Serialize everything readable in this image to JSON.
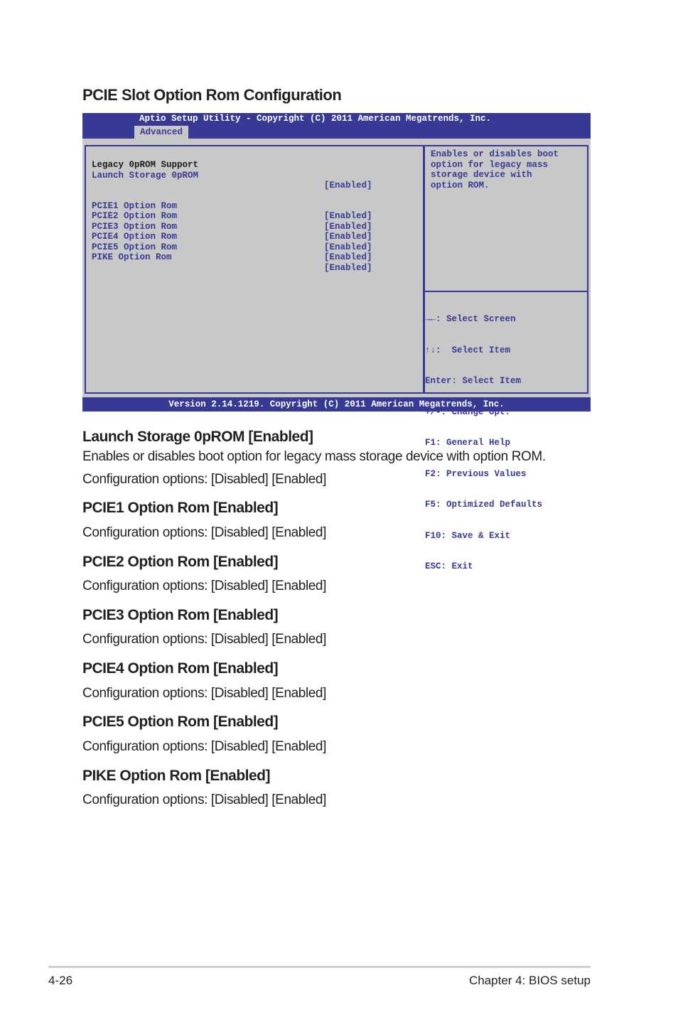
{
  "section_title": "PCIE Slot Option Rom Configuration",
  "bios": {
    "title": "Aptio Setup Utility - Copyright (C) 2011 American Megatrends, Inc.",
    "active_tab": "Advanced",
    "group_label": "Legacy 0pROM Support",
    "items": [
      {
        "label": "Launch Storage 0pROM",
        "value": "[Enabled]"
      },
      {
        "label": "PCIE1 Option Rom",
        "value": "[Enabled]"
      },
      {
        "label": "PCIE2 Option Rom",
        "value": "[Enabled]"
      },
      {
        "label": "PCIE3 Option Rom",
        "value": "[Enabled]"
      },
      {
        "label": "PCIE4 Option Rom",
        "value": "[Enabled]"
      },
      {
        "label": "PCIE5 Option Rom",
        "value": "[Enabled]"
      },
      {
        "label": "PIKE Option Rom",
        "value": "[Enabled]"
      }
    ],
    "help_text": "Enables or disables boot\noption for legacy mass\nstorage device with\noption ROM.",
    "key_legend": [
      "→←: Select Screen",
      "↑↓:  Select Item",
      "Enter: Select Item",
      "+/-: Change Opt.",
      "F1: General Help",
      "F2: Previous Values",
      "F5: Optimized Defaults",
      "F10: Save & Exit",
      "ESC: Exit"
    ],
    "footer": "Version 2.14.1219. Copyright (C) 2011 American Megatrends, Inc."
  },
  "descriptions": [
    {
      "title": "Launch Storage 0pROM [Enabled]",
      "text": "Enables or disables boot option for legacy mass storage device with option ROM.",
      "options": "Configuration options: [Disabled] [Enabled]"
    },
    {
      "title": "PCIE1 Option Rom [Enabled]",
      "options": "Configuration options: [Disabled] [Enabled]"
    },
    {
      "title": "PCIE2 Option Rom [Enabled]",
      "options": "Configuration options: [Disabled] [Enabled]"
    },
    {
      "title": "PCIE3 Option Rom [Enabled]",
      "options": "Configuration options: [Disabled] [Enabled]"
    },
    {
      "title": "PCIE4 Option Rom [Enabled]",
      "options": "Configuration options: [Disabled] [Enabled]"
    },
    {
      "title": "PCIE5 Option Rom [Enabled]",
      "options": "Configuration options: [Disabled] [Enabled]"
    },
    {
      "title": "PIKE Option Rom [Enabled]",
      "options": "Configuration options: [Disabled] [Enabled]"
    }
  ],
  "footer": {
    "page_number": "4-26",
    "chapter": "Chapter 4: BIOS setup"
  }
}
